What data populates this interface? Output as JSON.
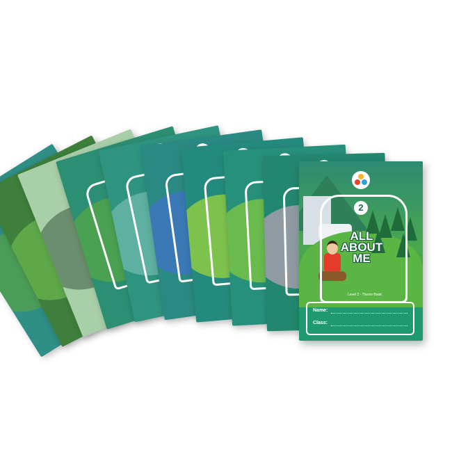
{
  "cover": {
    "level_number": "2",
    "title_line1": "ALL",
    "title_line2": "ABOUT",
    "title_line3": "ME",
    "subtitle": "Level 2 - Theme Book",
    "name_label": "Name:",
    "class_label": "Class:"
  },
  "colors": {
    "cover_green": "#1f9a70",
    "teal_book": "#2a8f86",
    "forest_book": "#3c8f4a"
  },
  "back_books": [
    {
      "name": "book-1",
      "color": "#2f8e86",
      "accent": "#4a9c58"
    },
    {
      "name": "book-2",
      "color": "#3e7f3c",
      "accent": "#7c5a32"
    },
    {
      "name": "book-3",
      "color": "#a9cfa8",
      "accent": "#6b8e6e"
    },
    {
      "name": "book-4",
      "color": "#2c8f73",
      "accent": "#4aa151"
    },
    {
      "name": "book-5",
      "color": "#2e9480",
      "accent": "#5eb0a1"
    },
    {
      "name": "book-6",
      "color": "#2a8a83",
      "accent": "#3a79b5"
    },
    {
      "name": "book-7",
      "color": "#258a7e",
      "accent": "#7ec24e"
    },
    {
      "name": "book-8",
      "color": "#27907b",
      "accent": "#e04545"
    },
    {
      "name": "book-9",
      "color": "#23876f",
      "accent": "#8f9aa3"
    }
  ]
}
